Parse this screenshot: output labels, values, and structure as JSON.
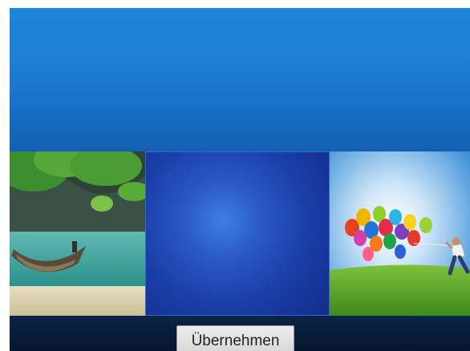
{
  "wallpaper_picker": {
    "preview": {
      "icon": "wallpaper-preview"
    },
    "thumbnails": [
      {
        "name": "beach-boat",
        "selected": false
      },
      {
        "name": "blue-gradient",
        "selected": true
      },
      {
        "name": "balloons-field",
        "selected": false
      }
    ],
    "apply_label": "Übernehmen",
    "colors": {
      "accent": "#1f80d8",
      "selected_border": "#2f6ad0"
    }
  }
}
